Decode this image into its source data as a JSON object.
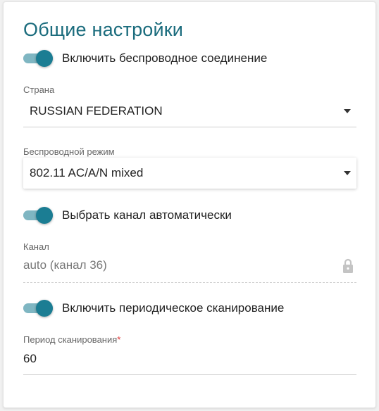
{
  "section": {
    "title": "Общие настройки"
  },
  "wireless_toggle": {
    "label": "Включить беспроводное соединение",
    "state": "on"
  },
  "country": {
    "label": "Страна",
    "value": "RUSSIAN FEDERATION"
  },
  "wireless_mode": {
    "label": "Беспроводной режим",
    "value": "802.11 AC/A/N mixed"
  },
  "auto_channel_toggle": {
    "label": "Выбрать канал автоматически",
    "state": "on"
  },
  "channel": {
    "label": "Канал",
    "value": "auto (канал 36)",
    "icon": "lock-icon"
  },
  "periodic_scan_toggle": {
    "label": "Включить периодическое сканирование",
    "state": "on"
  },
  "scan_period": {
    "label": "Период сканирования",
    "required_mark": "*",
    "value": "60"
  },
  "colors": {
    "accent": "#1b7d93",
    "title": "#1b6c7d",
    "required": "#dd3333"
  }
}
